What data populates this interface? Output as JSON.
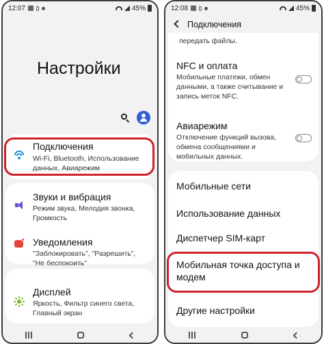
{
  "left_screen": {
    "status": {
      "time": "12:07",
      "battery": "45%"
    },
    "title": "Настройки",
    "items": [
      {
        "title": "Подключения",
        "subtitle": "Wi-Fi, Bluetooth, Использование данных, Авиарежим",
        "icon": "wifi-icon",
        "highlighted": true
      },
      {
        "title": "Звуки и вибрация",
        "subtitle": "Режим звука, Мелодия звонка, Громкость",
        "icon": "speaker-icon"
      },
      {
        "title": "Уведомления",
        "subtitle": "\"Заблокировать\", \"Разрешить\", \"Не беспокоить\"",
        "icon": "notification-icon"
      },
      {
        "title": "Дисплей",
        "subtitle": "Яркость, Фильтр синего света, Главный экран",
        "icon": "brightness-icon"
      }
    ]
  },
  "right_screen": {
    "status": {
      "time": "12:08",
      "battery": "45%"
    },
    "title": "Подключения",
    "cut_text": "передать файлы.",
    "items": [
      {
        "title": "NFC и оплата",
        "subtitle": "Мобильные платежи, обмен данными, а также считывание и запись меток NFC.",
        "toggle": "off"
      },
      {
        "title": "Авиарежим",
        "subtitle": "Отключение функций вызова, обмена сообщениями и мобильных данных.",
        "toggle": "off"
      },
      {
        "title": "Мобильные сети"
      },
      {
        "title": "Использование данных"
      },
      {
        "title": "Диспетчер SIM-карт"
      },
      {
        "title": "Мобильная точка доступа и модем",
        "highlighted": true
      },
      {
        "title": "Другие настройки"
      }
    ]
  },
  "colors": {
    "highlight": "#d0202a",
    "accent": "#2f5fd8"
  }
}
